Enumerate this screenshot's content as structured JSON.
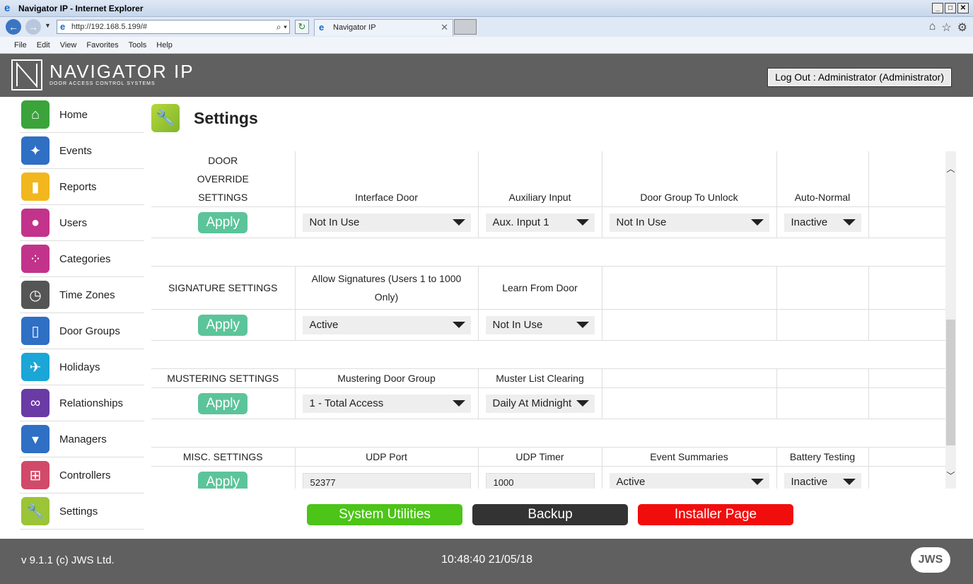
{
  "browser": {
    "title": "Navigator IP - Internet Explorer",
    "url": "http://192.168.5.199/#",
    "tab": "Navigator IP",
    "menu": [
      "File",
      "Edit",
      "View",
      "Favorites",
      "Tools",
      "Help"
    ]
  },
  "header": {
    "brand": "NAVIGATOR IP",
    "tagline": "DOOR ACCESS CONTROL SYSTEMS",
    "logout": "Log Out : Administrator (Administrator)"
  },
  "sidebar": {
    "items": [
      {
        "label": "Home",
        "icon": "home-icon",
        "color": "#3aa33a"
      },
      {
        "label": "Events",
        "icon": "events-icon",
        "color": "#2f6fc4"
      },
      {
        "label": "Reports",
        "icon": "reports-icon",
        "color": "#f2b71c"
      },
      {
        "label": "Users",
        "icon": "user-icon",
        "color": "#c2338c"
      },
      {
        "label": "Categories",
        "icon": "categories-icon",
        "color": "#c2338c"
      },
      {
        "label": "Time Zones",
        "icon": "clock-icon",
        "color": "#555555"
      },
      {
        "label": "Door Groups",
        "icon": "door-icon",
        "color": "#2f6fc4"
      },
      {
        "label": "Holidays",
        "icon": "plane-icon",
        "color": "#1aa6d6"
      },
      {
        "label": "Relationships",
        "icon": "link-icon",
        "color": "#6a3aa5"
      },
      {
        "label": "Managers",
        "icon": "tie-icon",
        "color": "#2f6fc4"
      },
      {
        "label": "Controllers",
        "icon": "network-icon",
        "color": "#d14a6a"
      },
      {
        "label": "Settings",
        "icon": "wrench-icon",
        "color": "#9bc437"
      }
    ]
  },
  "page": {
    "title": "Settings",
    "apply": "Apply"
  },
  "door_override": {
    "title": "DOOR OVERRIDE SETTINGS",
    "cols": [
      "Interface Door",
      "Auxiliary Input",
      "Door Group To Unlock",
      "Auto-Normal"
    ],
    "values": [
      "Not In Use",
      "Aux. Input 1",
      "Not In Use",
      "Inactive"
    ]
  },
  "signature": {
    "title": "SIGNATURE SETTINGS",
    "cols": [
      "Allow Signatures (Users 1 to 1000 Only)",
      "Learn From Door"
    ],
    "values": [
      "Active",
      "Not In Use"
    ]
  },
  "mustering": {
    "title": "MUSTERING SETTINGS",
    "cols": [
      "Mustering Door Group",
      "Muster List Clearing"
    ],
    "values": [
      "1 - Total Access",
      "Daily At Midnight"
    ]
  },
  "misc": {
    "title": "MISC. SETTINGS",
    "cols": [
      "UDP Port",
      "UDP Timer",
      "Event Summaries",
      "Battery Testing"
    ],
    "values": [
      "52377",
      "1000",
      "Active",
      "Inactive"
    ]
  },
  "buttons": {
    "system": "System Utilities",
    "backup": "Backup",
    "installer": "Installer Page"
  },
  "footer": {
    "version": "v 9.1.1 (c) JWS Ltd.",
    "time": "10:48:40 21/05/18",
    "logo": "JWS"
  }
}
